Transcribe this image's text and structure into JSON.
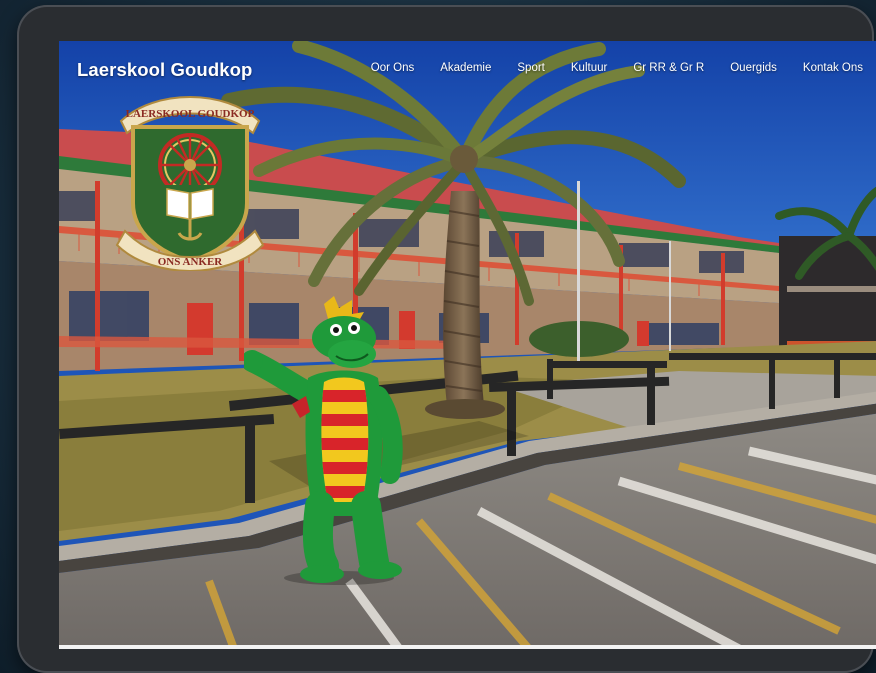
{
  "site": {
    "title": "Laerskool Goudkop"
  },
  "nav": {
    "items": [
      {
        "label": "Oor Ons"
      },
      {
        "label": "Akademie"
      },
      {
        "label": "Sport"
      },
      {
        "label": "Kultuur"
      },
      {
        "label": "Gr RR & Gr R"
      },
      {
        "label": "Ouergids"
      },
      {
        "label": "Kontak Ons"
      }
    ]
  },
  "crest": {
    "top_text": "LAERSKOOL GOUDKOP",
    "motto": "ONS ANKER"
  },
  "colors": {
    "sky": "#1e55b8",
    "roof": "#c94a4a",
    "wall": "#c9b290",
    "mascot_green": "#1f9a3a",
    "mascot_stripe_red": "#d8242a",
    "mascot_stripe_yellow": "#f2c81e",
    "crest_green": "#2f6a2e",
    "crest_gold": "#c9a64c"
  },
  "icons": [
    "school-crest-icon",
    "mascot-dragon"
  ]
}
